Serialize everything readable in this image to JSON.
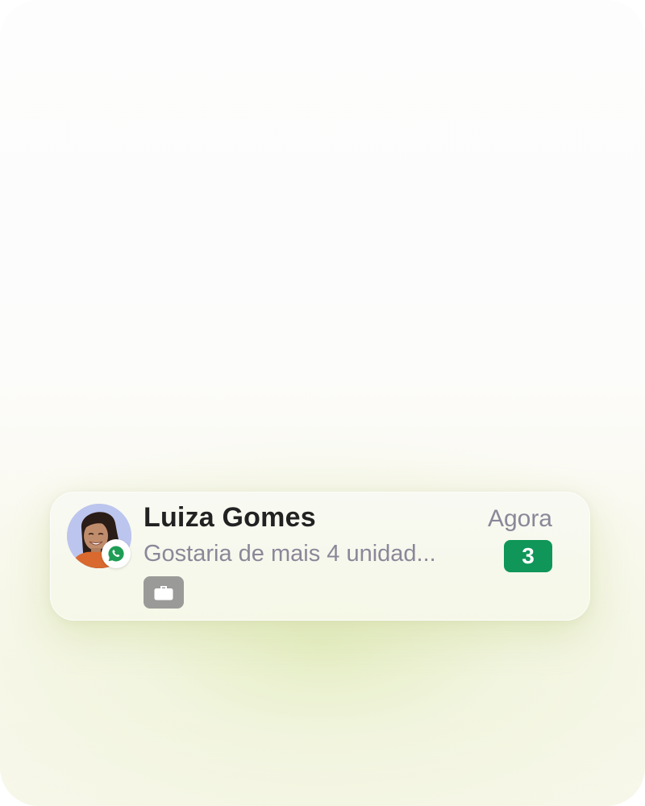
{
  "notification": {
    "contact_name": "Luiza Gomes",
    "time": "Agora",
    "message_preview": "Gostaria de mais 4 unidad...",
    "unread_count": "3",
    "channel_icon": "whatsapp-icon",
    "tag_icon": "briefcase-icon"
  },
  "colors": {
    "badge_green": "#0f9658",
    "tag_gray": "#9a9b98",
    "name_text": "#222222",
    "secondary_text": "#8b8799"
  }
}
